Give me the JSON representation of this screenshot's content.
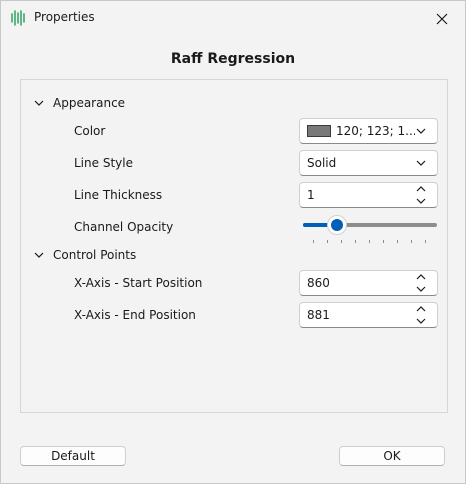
{
  "window": {
    "title": "Properties"
  },
  "dialog": {
    "heading": "Raff Regression"
  },
  "sections": {
    "appearance": {
      "label": "Appearance",
      "color": {
        "label": "Color",
        "value": "120; 123; 1...",
        "swatch": "#78797b"
      },
      "line_style": {
        "label": "Line Style",
        "value": "Solid"
      },
      "line_thickness": {
        "label": "Line Thickness",
        "value": "1"
      },
      "channel_opacity": {
        "label": "Channel Opacity",
        "level_percent": 25
      }
    },
    "control_points": {
      "label": "Control Points",
      "x_start": {
        "label": "X-Axis - Start Position",
        "value": "860"
      },
      "x_end": {
        "label": "X-Axis - End Position",
        "value": "881"
      }
    }
  },
  "buttons": {
    "default_label": "Default",
    "ok_label": "OK"
  },
  "colors": {
    "accent": "#005fb8",
    "icon_green": "#1f9d55"
  }
}
